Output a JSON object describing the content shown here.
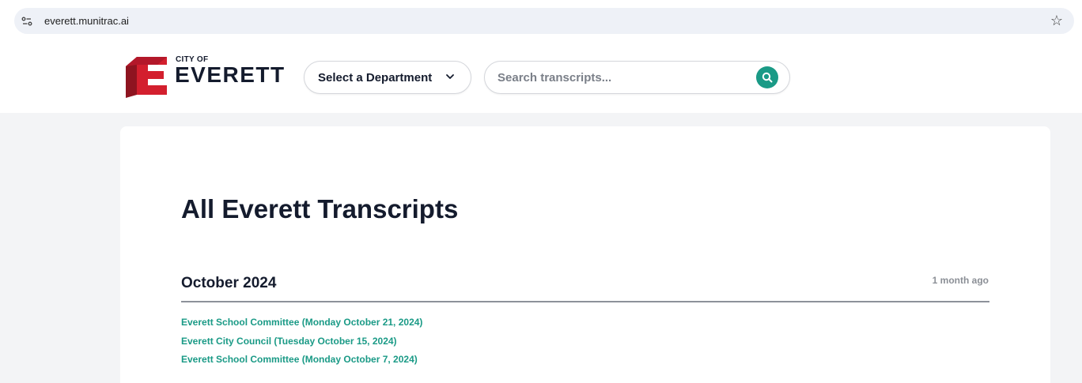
{
  "browser": {
    "url": "everett.munitrac.ai"
  },
  "header": {
    "logo": {
      "city_of": "CITY OF",
      "name": "EVERETT"
    },
    "department_select": {
      "label": "Select a Department"
    },
    "search": {
      "placeholder": "Search transcripts...",
      "value": ""
    }
  },
  "main": {
    "title": "All Everett Transcripts",
    "groups": [
      {
        "month": "October 2024",
        "age": "1 month ago",
        "items": [
          "Everett School Committee (Monday October 21, 2024)",
          "Everett City Council (Tuesday October 15, 2024)",
          "Everett School Committee (Monday October 7, 2024)"
        ]
      }
    ]
  },
  "colors": {
    "accent": "#1a9a86",
    "logo_red": "#d31f2e",
    "heading": "#141b2d",
    "page_bg": "#f3f4f6"
  },
  "icons": {
    "site_info": "site-info-icon",
    "bookmark": "star-icon",
    "dropdown": "chevron-down-icon",
    "search": "search-icon"
  }
}
